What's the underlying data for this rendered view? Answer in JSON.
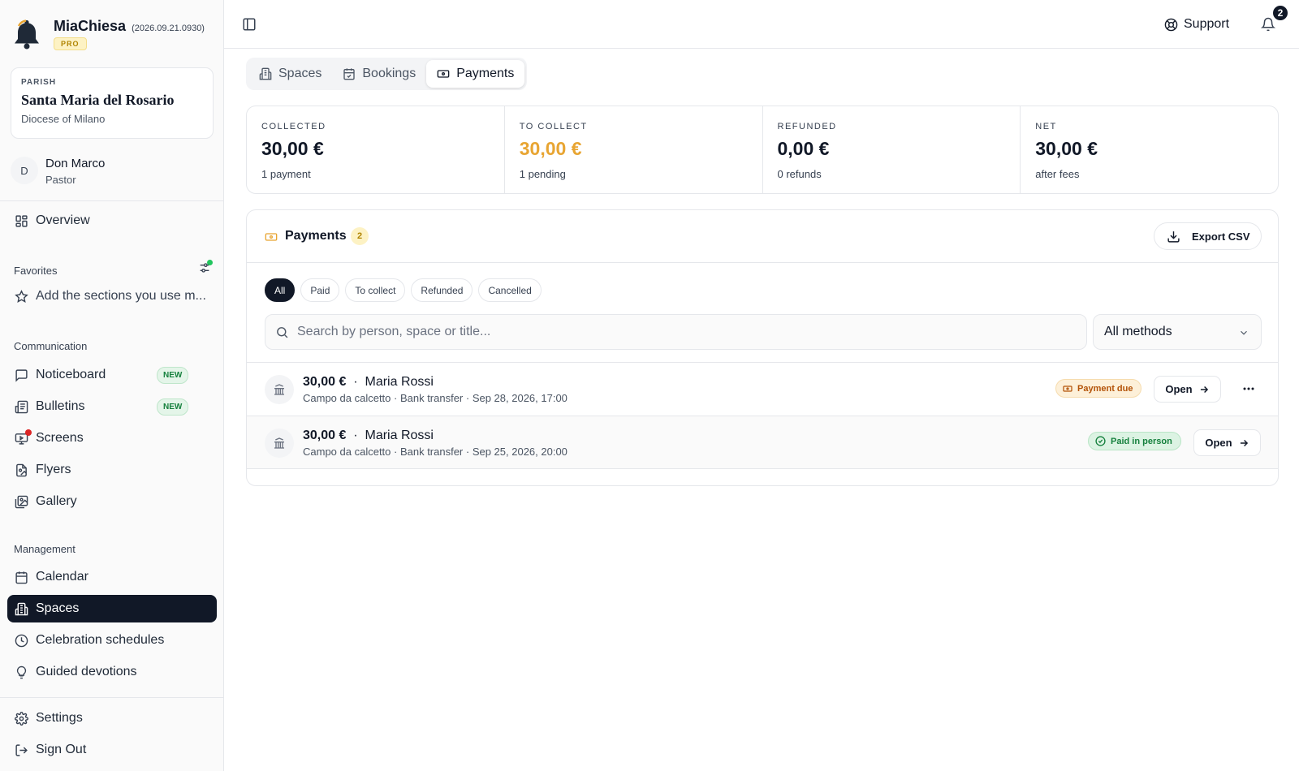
{
  "app": {
    "name": "MiaChiesa",
    "version": "(2026.09.21.0930)",
    "plan_badge": "PRO"
  },
  "parish": {
    "label": "PARISH",
    "name": "Santa Maria del Rosario",
    "diocese": "Diocese of Milano"
  },
  "user": {
    "initial": "D",
    "name": "Don Marco",
    "role": "Pastor"
  },
  "sidebar": {
    "overview": "Overview",
    "favorites": {
      "title": "Favorites",
      "add_hint": "Add the sections you use m..."
    },
    "communication": {
      "title": "Communication",
      "items": [
        {
          "label": "Noticeboard",
          "badge": "NEW",
          "icon": "message-square-icon"
        },
        {
          "label": "Bulletins",
          "badge": "NEW",
          "icon": "newspaper-icon"
        },
        {
          "label": "Screens",
          "icon": "monitor-icon"
        },
        {
          "label": "Flyers",
          "icon": "file-image-icon"
        },
        {
          "label": "Gallery",
          "icon": "images-icon"
        }
      ]
    },
    "management": {
      "title": "Management",
      "items": [
        {
          "label": "Calendar",
          "icon": "calendar-icon"
        },
        {
          "label": "Spaces",
          "icon": "building-icon",
          "active": true
        },
        {
          "label": "Celebration schedules",
          "icon": "clock-icon"
        },
        {
          "label": "Guided devotions",
          "icon": "lightbulb-icon"
        }
      ]
    },
    "settings": "Settings",
    "sign_out": "Sign Out"
  },
  "topbar": {
    "support": "Support",
    "notifications_count": "2"
  },
  "tabs": [
    {
      "label": "Spaces",
      "icon": "building-icon"
    },
    {
      "label": "Bookings",
      "icon": "calendar-check-icon"
    },
    {
      "label": "Payments",
      "icon": "banknote-icon",
      "active": true
    }
  ],
  "stats": [
    {
      "label": "COLLECTED",
      "value": "30,00 €",
      "sub": "1 payment"
    },
    {
      "label": "TO COLLECT",
      "value": "30,00 €",
      "sub": "1 pending"
    },
    {
      "label": "REFUNDED",
      "value": "0,00 €",
      "sub": "0 refunds"
    },
    {
      "label": "NET",
      "value": "30,00 €",
      "sub": "after fees"
    }
  ],
  "payments": {
    "title": "Payments",
    "count": "2",
    "export_label": "Export CSV",
    "filters": [
      "All",
      "Paid",
      "To collect",
      "Refunded",
      "Cancelled"
    ],
    "search_placeholder": "Search by person, space or title...",
    "method_select": "All methods",
    "rows": [
      {
        "amount": "30,00 €",
        "separator": "·",
        "person": "Maria Rossi",
        "details": "Campo da calcetto · Bank transfer · Sep 28, 2026, 17:00",
        "status": "Payment due",
        "action": "Open"
      },
      {
        "amount": "30,00 €",
        "separator": "·",
        "person": "Maria Rossi",
        "details": "Campo da calcetto · Bank transfer · Sep 25, 2026, 20:00",
        "status": "Paid in person",
        "action": "Open"
      }
    ]
  },
  "colors": {
    "accent_orange": "#e8a532",
    "dark": "#111827",
    "success": "#15803d",
    "new_badge_bg": "#e4f5e9"
  }
}
